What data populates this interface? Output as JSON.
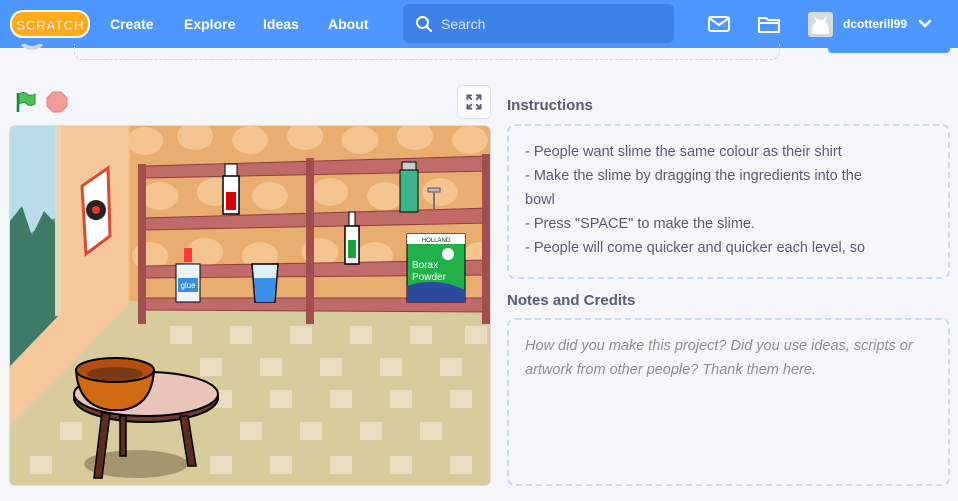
{
  "nav": {
    "logo_text": "SCRATCH",
    "links": [
      "Create",
      "Explore",
      "Ideas",
      "About"
    ],
    "search_placeholder": "Search",
    "username": "dcotterill99",
    "icons": [
      "messages-icon",
      "folder-icon",
      "chevron-down-icon"
    ],
    "color": "#4d97ff"
  },
  "stage": {
    "controls": [
      "green-flag-icon",
      "stop-icon",
      "fullscreen-icon"
    ],
    "sprites": {
      "glue_label": "glue",
      "borax_brand": "HOLLAND",
      "borax_line1": "Borax",
      "borax_line2": "Powder"
    }
  },
  "instructions": {
    "title": "Instructions",
    "lines": [
      "- People want slime the same colour as their shirt",
      "- Make the slime by dragging the ingredients into the",
      "bowl",
      "- Press \"SPACE\" to make the slime.",
      "",
      "- People will come quicker and quicker each level, so"
    ]
  },
  "notes": {
    "title": "Notes and Credits",
    "placeholder": "How did you make this project? Did you use ideas, scripts or artwork from other people? Thank them here."
  }
}
